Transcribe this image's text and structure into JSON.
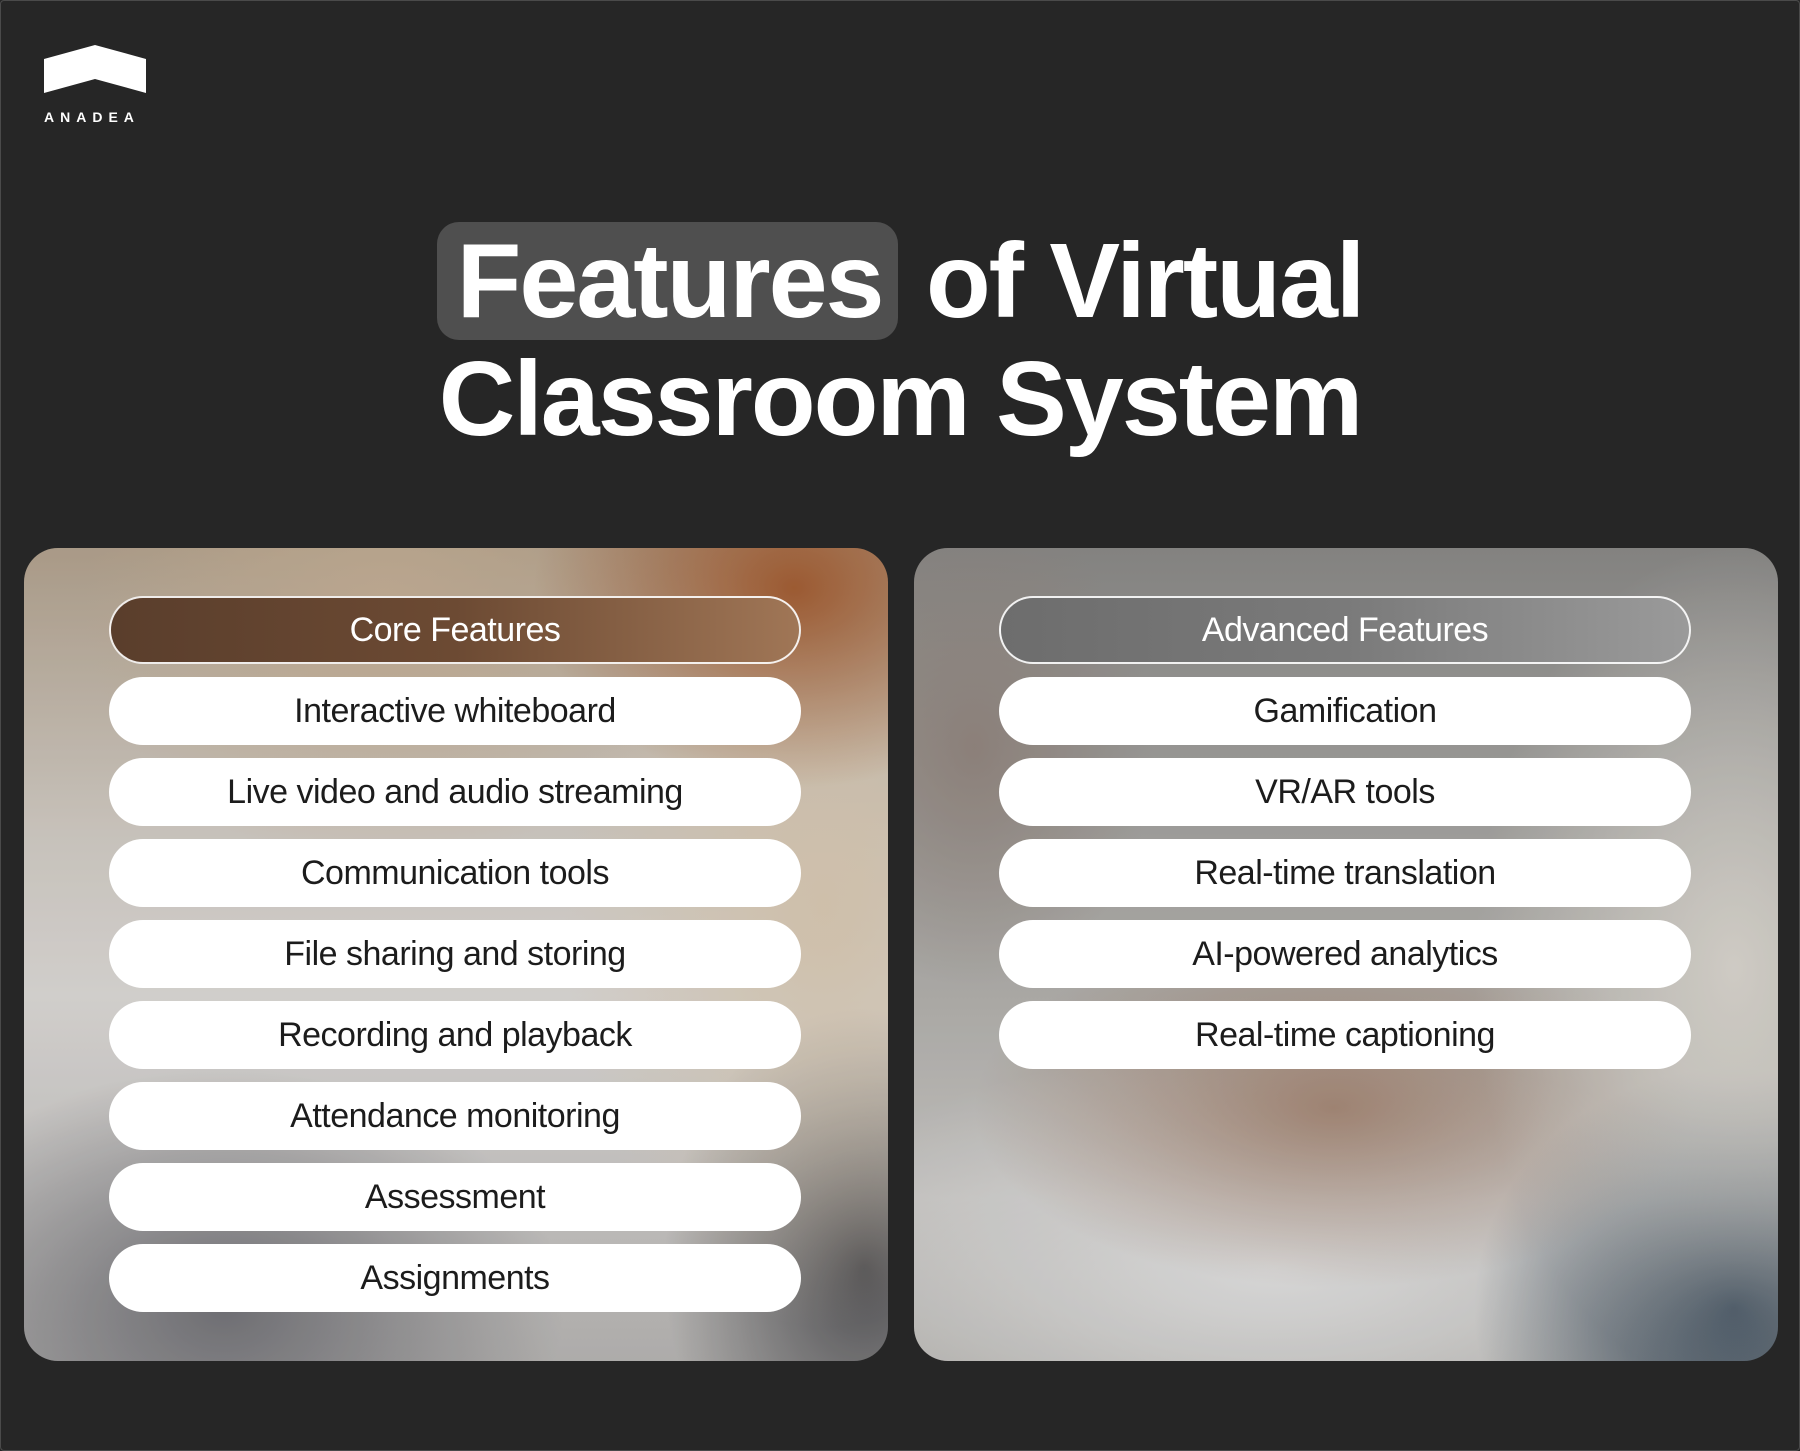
{
  "brand": {
    "name": "ANADEA"
  },
  "title": {
    "highlight": "Features",
    "rest_line1": "of Virtual",
    "line2": "Classroom System"
  },
  "core": {
    "header": "Core Features",
    "items": [
      "Interactive whiteboard",
      "Live video and audio streaming",
      "Communication tools",
      "File sharing and storing",
      "Recording and playback",
      "Attendance monitoring",
      "Assessment",
      "Assignments"
    ]
  },
  "advanced": {
    "header": "Advanced Features",
    "items": [
      "Gamification",
      "VR/AR tools",
      "Real-time translation",
      "AI-powered analytics",
      "Real-time captioning"
    ]
  },
  "colors": {
    "background": "#262626",
    "title_highlight": "#4f4f4f",
    "core_header": "#6c4a33",
    "advanced_header": "#7a7a7a",
    "pill": "#ffffff"
  }
}
